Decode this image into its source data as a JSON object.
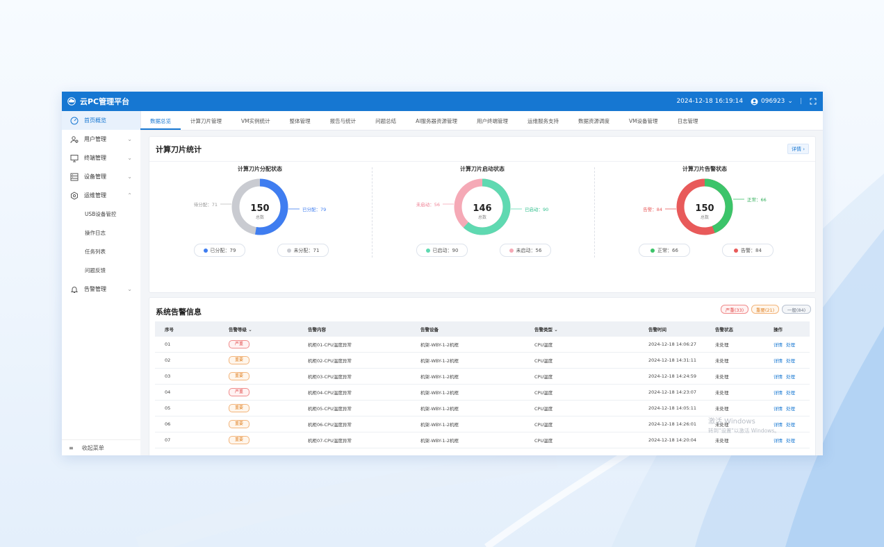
{
  "app": {
    "title": "云PC管理平台",
    "datetime": "2024-12-18 16:19:14",
    "user": "096923"
  },
  "sidebar": {
    "items": [
      {
        "label": "首页概览",
        "active": true
      },
      {
        "label": "用户管理"
      },
      {
        "label": "终端管理"
      },
      {
        "label": "设备管理"
      },
      {
        "label": "运维管理",
        "expanded": true
      }
    ],
    "sub_items": [
      "USB设备管控",
      "操作日志",
      "任务列表",
      "问题反馈"
    ],
    "alarm_item": "告警管理",
    "footer": "收起菜单"
  },
  "tabs": [
    "数据总览",
    "计算刀片管理",
    "VM实例统计",
    "整体管理",
    "报告与统计",
    "问题总结",
    "AI服务器资源管理",
    "用户终端管理",
    "运维服务支持",
    "数据资源调度",
    "VM设备管理",
    "日志管理"
  ],
  "blade_stats": {
    "title": "计算刀片统计",
    "detail_label": "详情",
    "charts": [
      {
        "title": "计算刀片分配状态",
        "total": "150",
        "unit": "总数",
        "left_label": "待分配：71",
        "right_label": "已分配：79",
        "pills": [
          "已分配：79",
          "未分配：71"
        ],
        "colors": {
          "primary": "#3f7df0",
          "secondary": "#c9cbd1"
        },
        "values": {
          "primary": 79,
          "secondary": 71
        }
      },
      {
        "title": "计算刀片启动状态",
        "total": "146",
        "unit": "总数",
        "left_label": "未启动：56",
        "right_label": "已启动：90",
        "pills": [
          "已启动：90",
          "未启动：56"
        ],
        "colors": {
          "primary": "#5fd9b1",
          "secondary": "#f5a9b6"
        },
        "values": {
          "primary": 90,
          "secondary": 56
        }
      },
      {
        "title": "计算刀片告警状态",
        "total": "150",
        "unit": "总数",
        "left_label": "告警：84",
        "right_label": "正常：66",
        "pills": [
          "正常：66",
          "告警：84"
        ],
        "colors": {
          "primary": "#3cc46a",
          "secondary": "#e85a5a"
        },
        "values": {
          "primary": 66,
          "secondary": 84
        }
      }
    ]
  },
  "alarms": {
    "title": "系统告警信息",
    "badges": [
      "严重(33)",
      "重要(21)",
      "一般(84)"
    ],
    "columns": [
      "序号",
      "告警等级",
      "告警内容",
      "告警设备",
      "告警类型",
      "告警时间",
      "告警状态",
      "操作"
    ],
    "rows": [
      [
        "01",
        "严重",
        "机柜01-CPU温度异常",
        "机架-WBY-1-2机框",
        "CPU温度",
        "2024-12-18 14:06:27",
        "未处理"
      ],
      [
        "02",
        "重要",
        "机柜02-CPU温度异常",
        "机架-WBY-1-2机框",
        "CPU温度",
        "2024-12-18 14:31:11",
        "未处理"
      ],
      [
        "03",
        "重要",
        "机柜03-CPU温度异常",
        "机架-WBY-1-2机框",
        "CPU温度",
        "2024-12-18 14:24:59",
        "未处理"
      ],
      [
        "04",
        "严重",
        "机柜04-CPU温度异常",
        "机架-WBY-1-2机框",
        "CPU温度",
        "2024-12-18 14:23:07",
        "未处理"
      ],
      [
        "05",
        "重要",
        "机柜05-CPU温度异常",
        "机架-WBY-1-2机框",
        "CPU温度",
        "2024-12-18 14:05:11",
        "未处理"
      ],
      [
        "06",
        "重要",
        "机柜06-CPU温度异常",
        "机架-WBY-1-2机框",
        "CPU温度",
        "2024-12-18 14:26:01",
        "未处理"
      ],
      [
        "07",
        "重要",
        "机柜07-CPU温度异常",
        "机架-WBY-1-2机框",
        "CPU温度",
        "2024-12-18 14:20:04",
        "未处理"
      ]
    ],
    "actions": [
      "详情",
      "处理"
    ]
  },
  "watermark": {
    "line1": "激活 Windows",
    "line2": "转到\"设置\"以激活 Windows。"
  },
  "colors": {
    "accent": "#1677d2",
    "severe": "#e14b4b",
    "important": "#e08327"
  }
}
